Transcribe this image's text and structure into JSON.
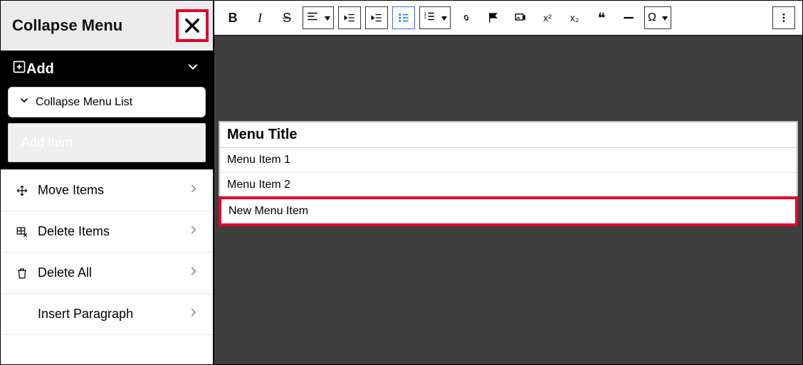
{
  "sidebar": {
    "title": "Collapse Menu",
    "add_section": {
      "label": "Add",
      "collapse_list_label": "Collapse Menu List",
      "add_item_label": "Add Item"
    },
    "rows": [
      {
        "label": "Move Items"
      },
      {
        "label": "Delete Items"
      },
      {
        "label": "Delete All"
      },
      {
        "label": "Insert Paragraph"
      }
    ]
  },
  "toolbar": {
    "bold": "B",
    "italic": "I",
    "strike": "S",
    "superscript": "x²",
    "subscript": "x₂",
    "quote": "❝",
    "omega": "Ω"
  },
  "canvas": {
    "menu_title": "Menu Title",
    "items": [
      "Menu Item 1",
      "Menu Item 2",
      "New Menu Item"
    ]
  }
}
